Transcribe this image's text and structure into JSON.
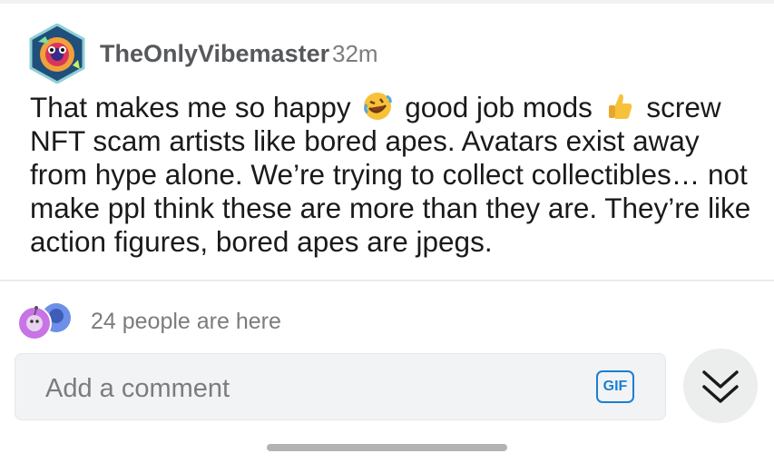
{
  "comment": {
    "username": "TheOnlyVibemaster",
    "timestamp": "32m",
    "text_part1": "That makes me so happy",
    "emoji1": "rolling-on-floor-laughing-emoji",
    "text_part2": "good job mods",
    "emoji2": "thumbs-up-emoji",
    "text_part3": "screw NFT scam artists like bored apes. Avatars exist away from hype alone. We’re trying to collect collectibles… not make ppl think these are more than they are. They’re like action figures, bored apes are jpegs."
  },
  "presence": {
    "text": "24 people are here"
  },
  "composer": {
    "placeholder": "Add a comment",
    "gif_label": "GIF"
  },
  "colors": {
    "accent_blue": "#1a7fd1",
    "muted_text": "#7c7c7c",
    "input_bg": "#f2f3f5"
  }
}
